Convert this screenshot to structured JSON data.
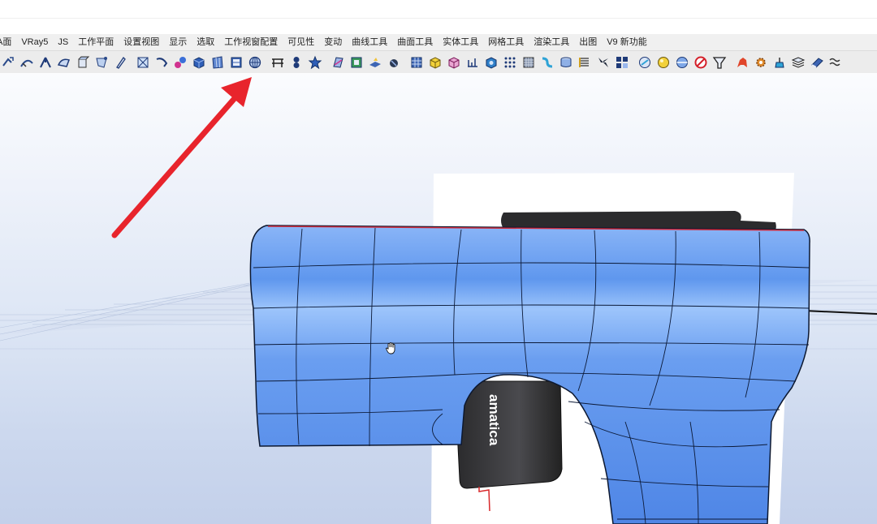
{
  "menu": {
    "items": [
      "A面",
      "VRay5",
      "JS",
      "工作平面",
      "设置视图",
      "显示",
      "选取",
      "工作视窗配置",
      "可见性",
      "变动",
      "曲线工具",
      "曲面工具",
      "实体工具",
      "网格工具",
      "渲染工具",
      "出图",
      "V9 新功能"
    ]
  },
  "toolbar": {
    "groups": [
      [
        "rotate-arrow-icon",
        "sweep-icon",
        "blend-curve-icon",
        "patch-icon",
        "extrude-icon",
        "loft-icon",
        "edit-pen-icon"
      ],
      [
        "network-surface-icon",
        "rail-revolve-icon",
        "join-sphere-icon",
        "box-icon",
        "panel-icon",
        "grid-panel-icon",
        "sphere-mesh-icon"
      ],
      [
        "railing-icon",
        "figure-eight-icon",
        "star-icon"
      ],
      [
        "plane-surface-icon",
        "frame-surface-icon",
        "ribbon-icon",
        "rotate-solid-icon"
      ],
      [
        "grid-block-icon",
        "yellow-cube-icon",
        "pink-cube-icon",
        "section-icon",
        "blue-cube-icon",
        "dots-grid-icon",
        "mesh-block-icon",
        "flow-icon",
        "cylinder-icon",
        "list-icon",
        "propeller-icon",
        "bolt-icon"
      ],
      [
        "boolean-icon",
        "yellow-sphere-icon",
        "split-sphere-icon",
        "no-entry-icon",
        "funnel-icon"
      ],
      [
        "red-figure-icon",
        "gear-icon",
        "lamp-icon",
        "layers-icon",
        "book-icon",
        "wave-icon"
      ]
    ]
  },
  "viewport": {
    "product_label": "amatica"
  },
  "colors": {
    "surface": "#6a9ef0",
    "arrow": "#e8242c"
  }
}
